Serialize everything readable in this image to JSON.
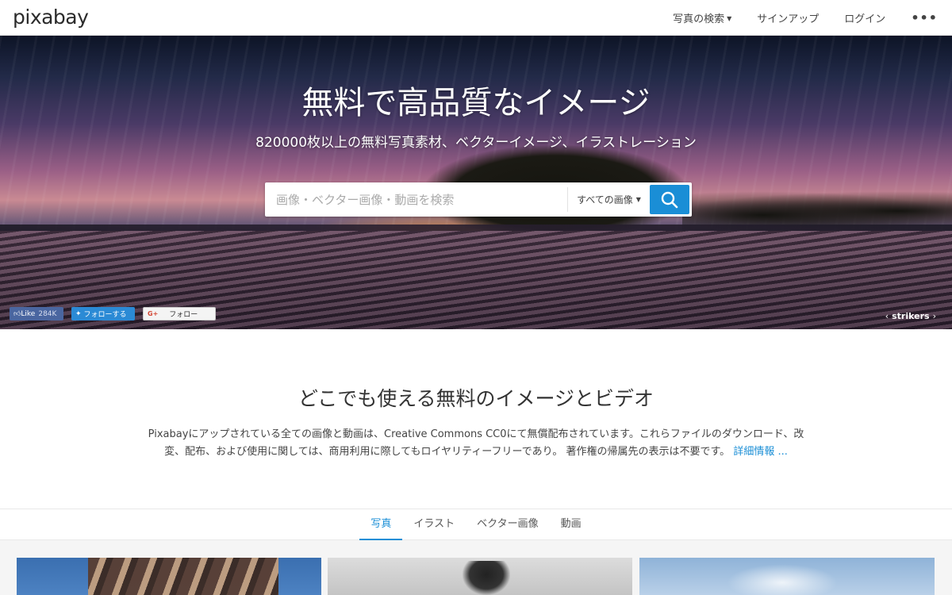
{
  "header": {
    "logo": "pixabay",
    "nav": {
      "search_photos": "写真の検索",
      "signup": "サインアップ",
      "login": "ログイン",
      "more": "•••"
    }
  },
  "hero": {
    "title": "無料で高品質なイメージ",
    "subtitle": "820000枚以上の無料写真素材、ベクターイメージ、イラストレーション",
    "search": {
      "placeholder": "画像・ベクター画像・動画を検索",
      "value": "",
      "type_selected": "すべての画像",
      "button_icon": "search-icon"
    },
    "social": {
      "facebook_label": "Like",
      "facebook_count": "284K",
      "twitter_label": "フォローする",
      "google_label": "フォロー",
      "google_badge": "G+"
    },
    "credit": {
      "author": "strikers",
      "prev": "‹",
      "next": "›"
    }
  },
  "intro": {
    "title": "どこでも使える無料のイメージとビデオ",
    "text": "Pixabayにアップされている全ての画像と動画は、Creative Commons CC0にて無償配布されています。これらファイルのダウンロード、改変、配布、および使用に関しては、商用利用に際してもロイヤリティーフリーであり。 著作権の帰属先の表示は不要です。",
    "link": "詳細情報 ..."
  },
  "tabs": [
    {
      "label": "写真",
      "active": true
    },
    {
      "label": "イラスト",
      "active": false
    },
    {
      "label": "ベクター画像",
      "active": false
    },
    {
      "label": "動画",
      "active": false
    }
  ],
  "colors": {
    "accent": "#1a8ed6",
    "facebook": "#4a66a0",
    "twitter": "#2b8ad5"
  }
}
